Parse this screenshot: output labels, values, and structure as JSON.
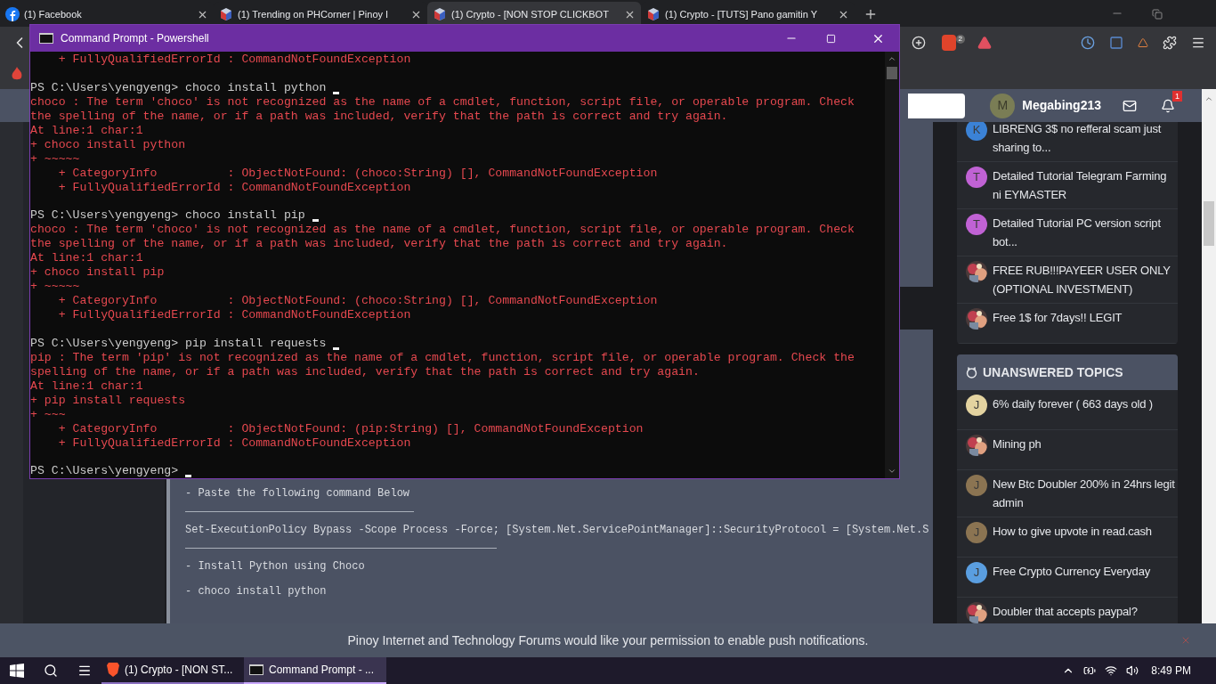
{
  "browser": {
    "tabs": [
      {
        "title": "(1) Facebook",
        "selected": false
      },
      {
        "title": "(1) Trending on PHCorner | Pinoy I",
        "selected": false
      },
      {
        "title": "(1) Crypto - [NON STOP CLICKBOT",
        "selected": true
      },
      {
        "title": "(1) Crypto - [TUTS] Pano gamitin Y",
        "selected": false
      }
    ],
    "shield_badge": "2"
  },
  "console": {
    "title": "Command Prompt - Powershell",
    "lines": [
      {
        "kind": "error",
        "text": "    + FullyQualifiedErrorId : CommandNotFoundException"
      },
      {
        "kind": "blank"
      },
      {
        "kind": "prompt",
        "text": "PS C:\\Users\\yengyeng> choco install python",
        "cursor": true
      },
      {
        "kind": "error",
        "text": "choco : The term 'choco' is not recognized as the name of a cmdlet, function, script file, or operable program. Check"
      },
      {
        "kind": "error",
        "text": "the spelling of the name, or if a path was included, verify that the path is correct and try again."
      },
      {
        "kind": "error",
        "text": "At line:1 char:1"
      },
      {
        "kind": "error",
        "text": "+ choco install python"
      },
      {
        "kind": "error",
        "text": "+ ~~~~~"
      },
      {
        "kind": "error",
        "text": "    + CategoryInfo          : ObjectNotFound: (choco:String) [], CommandNotFoundException"
      },
      {
        "kind": "error",
        "text": "    + FullyQualifiedErrorId : CommandNotFoundException"
      },
      {
        "kind": "blank"
      },
      {
        "kind": "prompt",
        "text": "PS C:\\Users\\yengyeng> choco install pip",
        "cursor": true
      },
      {
        "kind": "error",
        "text": "choco : The term 'choco' is not recognized as the name of a cmdlet, function, script file, or operable program. Check"
      },
      {
        "kind": "error",
        "text": "the spelling of the name, or if a path was included, verify that the path is correct and try again."
      },
      {
        "kind": "error",
        "text": "At line:1 char:1"
      },
      {
        "kind": "error",
        "text": "+ choco install pip"
      },
      {
        "kind": "error",
        "text": "+ ~~~~~"
      },
      {
        "kind": "error",
        "text": "    + CategoryInfo          : ObjectNotFound: (choco:String) [], CommandNotFoundException"
      },
      {
        "kind": "error",
        "text": "    + FullyQualifiedErrorId : CommandNotFoundException"
      },
      {
        "kind": "blank"
      },
      {
        "kind": "prompt",
        "text": "PS C:\\Users\\yengyeng> pip install requests",
        "cursor": true
      },
      {
        "kind": "error",
        "text": "pip : The term 'pip' is not recognized as the name of a cmdlet, function, script file, or operable program. Check the"
      },
      {
        "kind": "error",
        "text": "spelling of the name, or if a path was included, verify that the path is correct and try again."
      },
      {
        "kind": "error",
        "text": "At line:1 char:1"
      },
      {
        "kind": "error",
        "text": "+ pip install requests"
      },
      {
        "kind": "error",
        "text": "+ ~~~"
      },
      {
        "kind": "error",
        "text": "    + CategoryInfo          : ObjectNotFound: (pip:String) [], CommandNotFoundException"
      },
      {
        "kind": "error",
        "text": "    + FullyQualifiedErrorId : CommandNotFoundException"
      },
      {
        "kind": "blank"
      },
      {
        "kind": "prompt",
        "text": "PS C:\\Users\\yengyeng>",
        "cursor": true
      }
    ]
  },
  "forum": {
    "user": {
      "avatar_letter": "M",
      "name": "Megabing213",
      "notification_count": "1"
    },
    "post_lines": [
      {
        "kind": "text",
        "text": "- Paste the following command Below"
      },
      {
        "kind": "rule"
      },
      {
        "kind": "text",
        "text": "Set-ExecutionPolicy Bypass -Scope Process -Force; [System.Net.ServicePointManager]::SecurityProtocol = [System.Net.S"
      },
      {
        "kind": "rule"
      },
      {
        "kind": "text",
        "text": "- Install Python using Choco"
      },
      {
        "kind": "text",
        "text": "- choco install python"
      }
    ],
    "sidebar": [
      {
        "topics": [
          {
            "title": "LIBRENG 3$ no refferal scam just sharing to...",
            "avatar": {
              "kind": "letter",
              "letter": "K",
              "color": "#3b82d6"
            }
          },
          {
            "title": "Detailed Tutorial Telegram Farming ni EYMASTER",
            "avatar": {
              "kind": "letter",
              "letter": "T",
              "color": "#c062d4"
            }
          },
          {
            "title": "Detailed Tutorial PC version script bot...",
            "avatar": {
              "kind": "letter",
              "letter": "T",
              "color": "#c062d4"
            }
          },
          {
            "title": "FREE RUB!!!PAYEER USER ONLY (OPTIONAL INVESTMENT)"
          },
          {
            "title": "Free 1$ for 7days!! LEGIT"
          }
        ]
      },
      {
        "title": "UNANSWERED TOPICS",
        "topics": [
          {
            "title": "6% daily forever ( 663 days old )",
            "avatar": {
              "kind": "letter",
              "letter": "J",
              "color": "#e3d3a0"
            }
          },
          {
            "title": "Mining ph"
          },
          {
            "title": "New Btc Doubler 200% in 24hrs legit admin",
            "avatar": {
              "kind": "letter",
              "letter": "J",
              "color": "#8b7452"
            }
          },
          {
            "title": "How to give upvote in read.cash",
            "avatar": {
              "kind": "letter",
              "letter": "J",
              "color": "#8b7452"
            }
          },
          {
            "title": "Free Crypto Currency Everyday",
            "avatar": {
              "kind": "letter",
              "letter": "J",
              "color": "#5a9ee0"
            }
          },
          {
            "title": "Doubler that accepts paypal?"
          }
        ]
      }
    ]
  },
  "notification_bar": {
    "text": "Pinoy Internet and Technology Forums would like your permission to enable push notifications."
  },
  "taskbar": {
    "items": [
      {
        "title": "(1) Crypto - [NON ST...",
        "selected": false
      },
      {
        "title": "Command Prompt - ...",
        "selected": true
      }
    ],
    "clock": "8:49 PM"
  }
}
